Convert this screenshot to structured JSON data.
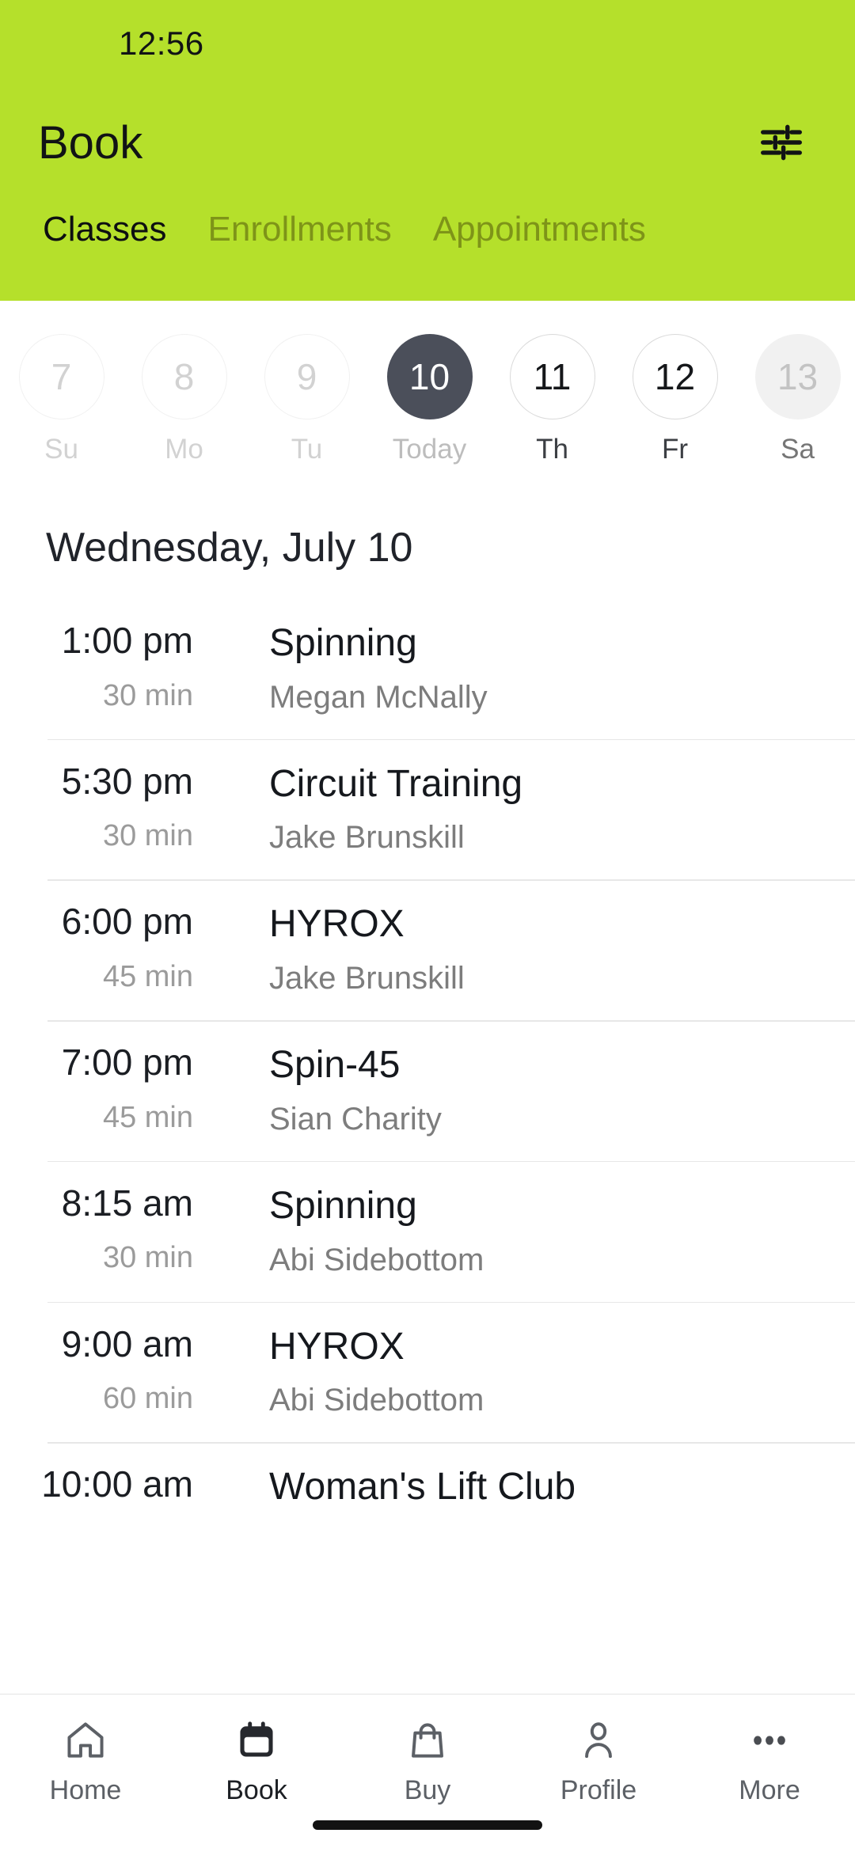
{
  "status_bar": {
    "clock": "12:56"
  },
  "header": {
    "title": "Book",
    "filter_icon": "tune-sliders-icon",
    "accent_color": "#b5e02b",
    "tabs": [
      {
        "label": "Classes",
        "active": true
      },
      {
        "label": "Enrollments",
        "active": false
      },
      {
        "label": "Appointments",
        "active": false
      }
    ]
  },
  "date_strip": {
    "days": [
      {
        "num": "7",
        "dow": "Su",
        "state": "past"
      },
      {
        "num": "8",
        "dow": "Mo",
        "state": "past"
      },
      {
        "num": "9",
        "dow": "Tu",
        "state": "past"
      },
      {
        "num": "10",
        "dow": "Today",
        "state": "selected"
      },
      {
        "num": "11",
        "dow": "Th",
        "state": "avail"
      },
      {
        "num": "12",
        "dow": "Fr",
        "state": "avail"
      },
      {
        "num": "13",
        "dow": "Sa",
        "state": "muted"
      }
    ],
    "selected_color": "#4b4f5a"
  },
  "day_heading": "Wednesday, July 10",
  "classes": [
    {
      "time": "1:00 pm",
      "duration": "30 min",
      "name": "Spinning",
      "instructor": "Megan McNally"
    },
    {
      "time": "5:30 pm",
      "duration": "30 min",
      "name": "Circuit Training",
      "instructor": "Jake Brunskill"
    },
    {
      "time": "6:00 pm",
      "duration": "45 min",
      "name": "HYROX",
      "instructor": "Jake Brunskill"
    },
    {
      "time": "7:00 pm",
      "duration": "45 min",
      "name": "Spin-45",
      "instructor": "Sian Charity"
    },
    {
      "time": "8:15 am",
      "duration": "30 min",
      "name": "Spinning",
      "instructor": "Abi Sidebottom"
    },
    {
      "time": "9:00 am",
      "duration": "60 min",
      "name": "HYROX",
      "instructor": "Abi Sidebottom"
    },
    {
      "time": "10:00 am",
      "duration": "",
      "name": "Woman's Lift Club",
      "instructor": ""
    }
  ],
  "bottom_nav": {
    "items": [
      {
        "label": "Home",
        "icon": "home-icon",
        "active": false
      },
      {
        "label": "Book",
        "icon": "calendar-icon",
        "active": true
      },
      {
        "label": "Buy",
        "icon": "bag-icon",
        "active": false
      },
      {
        "label": "Profile",
        "icon": "person-icon",
        "active": false
      },
      {
        "label": "More",
        "icon": "ellipsis-icon",
        "active": false
      }
    ]
  }
}
